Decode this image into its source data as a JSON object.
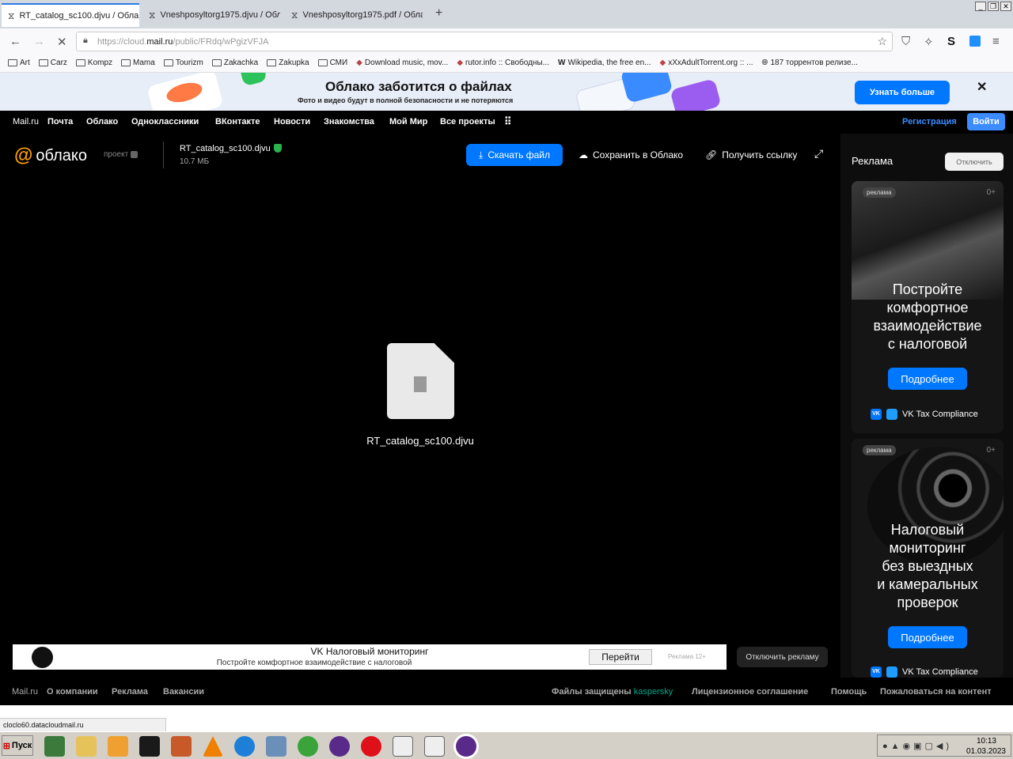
{
  "browser": {
    "tabs": [
      {
        "label": "RT_catalog_sc100.djvu / Облак",
        "active": true
      },
      {
        "label": "Vneshposyltorg1975.djvu / Обл",
        "active": false
      },
      {
        "label": "Vneshposyltorg1975.pdf / Обла",
        "active": false
      }
    ],
    "url_prefix": "https://cloud.",
    "url_host": "mail.ru",
    "url_path": "/public/FRdq/wPgizVFJA",
    "bookmarks": [
      {
        "label": "Art",
        "icon": "folder-icon"
      },
      {
        "label": "Carz",
        "icon": "folder-icon"
      },
      {
        "label": "Kompz",
        "icon": "folder-icon"
      },
      {
        "label": "Mama",
        "icon": "folder-icon"
      },
      {
        "label": "Tourizm",
        "icon": "folder-icon"
      },
      {
        "label": "Zakachka",
        "icon": "folder-icon"
      },
      {
        "label": "Zakupka",
        "icon": "folder-icon"
      },
      {
        "label": "СМИ",
        "icon": "folder-icon"
      },
      {
        "label": "Download music, mov...",
        "icon": "site-icon"
      },
      {
        "label": "rutor.info :: Свободны...",
        "icon": "site-icon"
      },
      {
        "label": "Wikipedia, the free en...",
        "icon": "wikipedia-icon"
      },
      {
        "label": "xXxAdultTorrent.org :: ...",
        "icon": "site-icon"
      },
      {
        "label": "187 торрентов релизе...",
        "icon": "globe-icon"
      }
    ]
  },
  "promo": {
    "title": "Облако заботится о файлах",
    "subtitle": "Фото и видео будут в полной безопасности и не потеряются",
    "button": "Узнать больше"
  },
  "portal_nav": {
    "items": [
      "Mail.ru",
      "Почта",
      "Облако",
      "Одноклассники",
      "ВКонтакте",
      "Новости",
      "Знакомства",
      "Мой Мир",
      "Все проекты"
    ],
    "register": "Регистрация",
    "login": "Войти"
  },
  "cloud_header": {
    "logo": "облако",
    "project": "проект",
    "file_name": "RT_catalog_sc100.djvu",
    "file_size": "10.7 МБ",
    "download": "Скачать файл",
    "save": "Сохранить в Облако",
    "get_link": "Получить ссылку"
  },
  "preview": {
    "file_name": "RT_catalog_sc100.djvu"
  },
  "bottom_ad": {
    "title": "VK Налоговый мониторинг",
    "subtitle": "Постройте комфортное взаимодействие с налоговой",
    "button": "Перейти",
    "label": "Реклама 12+",
    "disable": "Отключить рекламу"
  },
  "side_ads": {
    "heading": "Реклама",
    "disable": "Отключить",
    "cards": [
      {
        "tag": "реклама",
        "age": "0+",
        "headline": [
          "Постройте",
          "комфортное",
          "взаимодействие",
          "с налоговой"
        ],
        "button": "Подробнее",
        "brand": "VK Tax Compliance"
      },
      {
        "tag": "реклама",
        "age": "0+",
        "headline": [
          "Налоговый",
          "мониторинг",
          "без выездных",
          "и камеральных",
          "проверок"
        ],
        "button": "Подробнее",
        "brand": "VK Tax Compliance"
      }
    ]
  },
  "footer": {
    "left": [
      "Mail.ru",
      "О компании",
      "Реклама",
      "Вакансии"
    ],
    "protected": "Файлы защищены",
    "kaspersky": "kaspersky",
    "right": [
      "Лицензионное соглашение",
      "Помощь",
      "Пожаловаться на контент"
    ]
  },
  "status_url": "cloclo60.datacloudmail.ru",
  "taskbar": {
    "start": "Пуск",
    "time": "10:13",
    "date": "01.03.2023"
  },
  "colors": {
    "accent": "#0077ff",
    "logo_orange": "#ff9e00",
    "kaspersky": "#00a88e"
  }
}
